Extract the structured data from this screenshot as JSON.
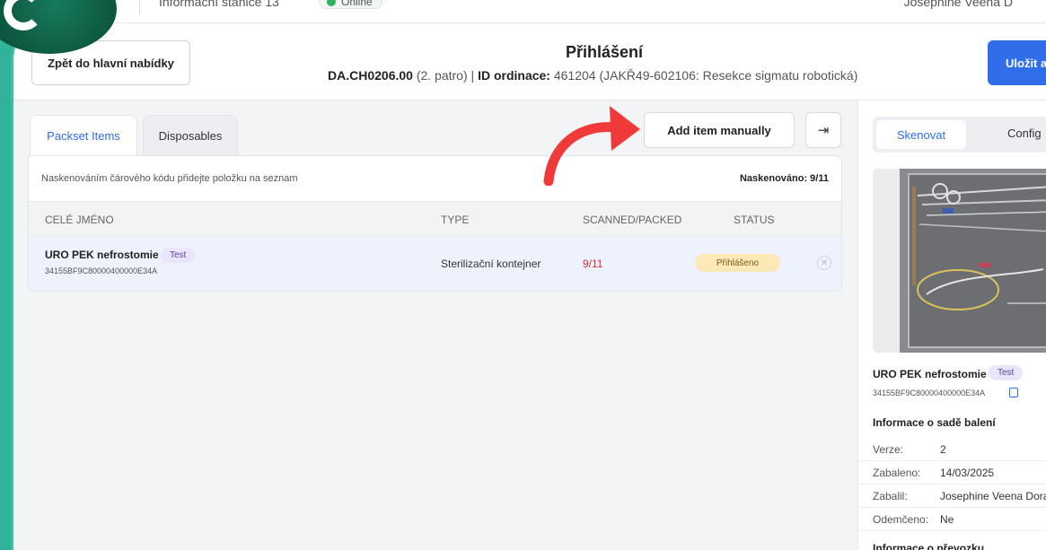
{
  "topbar": {
    "station": "Informační stanice 13",
    "status": "Online",
    "user": "Josephine Veena D"
  },
  "header": {
    "back_label": "Zpět do hlavní nabídky",
    "title": "Přihlášení",
    "location_code": "DA.CH0206.00",
    "floor": "(2. patro)",
    "id_label": "ID ordinace:",
    "id_value": "461204 (JAKŘ49-602106: Resekce sigmatu robotická)",
    "save_label": "Uložit a"
  },
  "tabs": [
    {
      "label": "Packset Items",
      "active": true
    },
    {
      "label": "Disposables",
      "active": false
    }
  ],
  "toolbar": {
    "add_label": "Add item manually",
    "collapse_icon": "collapse-right-icon"
  },
  "list": {
    "hint": "Naskenováním čárového kódu přidejte položku na seznam",
    "count": "Naskenováno: 9/11",
    "columns": [
      "CELÉ JMÉNO",
      "TYPE",
      "SCANNED/PACKED",
      "STATUS"
    ],
    "rows": [
      {
        "name": "URO PEK nefrostomie",
        "badge": "Test",
        "code": "34155BF9C80000400000E34A",
        "type": "Sterilizační kontejner",
        "scanned": "9/11",
        "status": "Přihlášeno"
      }
    ]
  },
  "right": {
    "tabs": [
      "Skenovat",
      "Config"
    ],
    "name": "URO PEK nefrostomie",
    "badge": "Test",
    "code": "34155BF9C80000400000E34A",
    "section_title": "Informace o sadě balení",
    "details": [
      {
        "k": "Verze:",
        "v": "2"
      },
      {
        "k": "Zabaleno:",
        "v": "14/03/2025"
      },
      {
        "k": "Zabalil:",
        "v": "Josephine Veena Dora"
      },
      {
        "k": "Odemčeno:",
        "v": "Ne"
      }
    ],
    "section_title_2": "Informace o převozku"
  },
  "colors": {
    "accent": "#2f6ee8",
    "brand": "#2fb39b",
    "arrow": "#f03a3a",
    "status_bg": "#fde8b8"
  }
}
